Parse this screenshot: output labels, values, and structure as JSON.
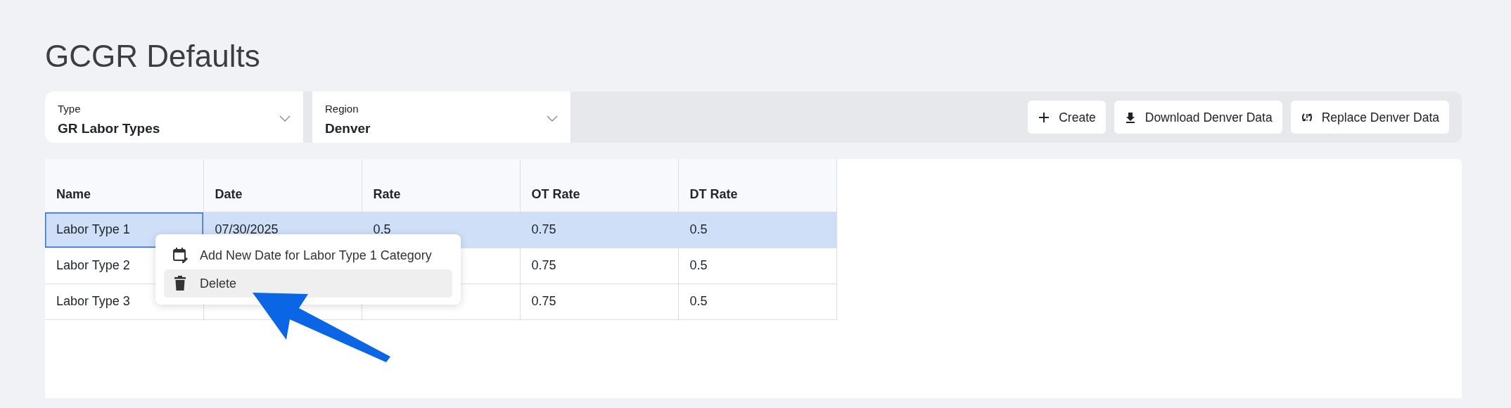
{
  "page": {
    "title": "GCGR Defaults"
  },
  "filters": [
    {
      "label": "Type",
      "value": "GR Labor Types"
    },
    {
      "label": "Region",
      "value": "Denver"
    }
  ],
  "actions": [
    {
      "kind": "create",
      "label": "Create"
    },
    {
      "kind": "download",
      "label": "Download Denver Data"
    },
    {
      "kind": "replace",
      "label": "Replace Denver Data"
    }
  ],
  "table": {
    "columns": [
      "Name",
      "Date",
      "Rate",
      "OT Rate",
      "DT Rate"
    ],
    "rows": [
      {
        "selected": true,
        "focused": true,
        "cells": [
          "Labor Type 1",
          "07/30/2025",
          "0.5",
          "0.75",
          "0.5"
        ]
      },
      {
        "selected": false,
        "focused": false,
        "cells": [
          "Labor Type 2",
          null,
          null,
          "0.75",
          "0.5"
        ]
      },
      {
        "selected": false,
        "focused": false,
        "cells": [
          "Labor Type 3",
          null,
          null,
          "0.75",
          "0.5"
        ]
      }
    ]
  },
  "context_menu": {
    "items": [
      {
        "kind": "add-date",
        "label": "Add New Date for Labor Type 1 Category",
        "highlighted": false
      },
      {
        "kind": "delete",
        "label": "Delete",
        "highlighted": true
      }
    ]
  }
}
